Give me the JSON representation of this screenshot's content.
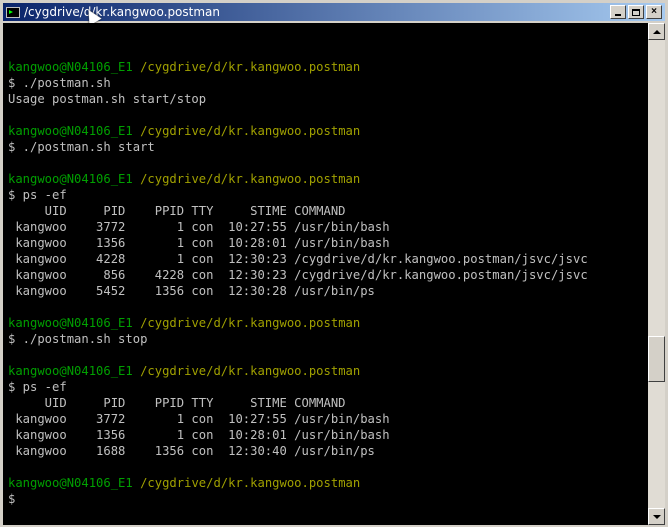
{
  "window": {
    "title": "/cygdrive/d/kr.kangwoo.postman",
    "buttons": {
      "minimize": "_",
      "maximize": "□",
      "close": "×"
    }
  },
  "terminal": {
    "prompt_user": "kangwoo@N04106_E1",
    "prompt_path": "/cygdrive/d/kr.kangwoo.postman",
    "lines": [
      "",
      "__PROMPT__",
      "$ ./postman.sh",
      "Usage postman.sh start/stop",
      "",
      "__PROMPT__",
      "$ ./postman.sh start",
      "",
      "__PROMPT__",
      "$ ps -ef",
      "     UID     PID    PPID TTY     STIME COMMAND",
      " kangwoo    3772       1 con  10:27:55 /usr/bin/bash",
      " kangwoo    1356       1 con  10:28:01 /usr/bin/bash",
      " kangwoo    4228       1 con  12:30:23 /cygdrive/d/kr.kangwoo.postman/jsvc/jsvc",
      " kangwoo     856    4228 con  12:30:23 /cygdrive/d/kr.kangwoo.postman/jsvc/jsvc",
      " kangwoo    5452    1356 con  12:30:28 /usr/bin/ps",
      "",
      "__PROMPT__",
      "$ ./postman.sh stop",
      "",
      "__PROMPT__",
      "$ ps -ef",
      "     UID     PID    PPID TTY     STIME COMMAND",
      " kangwoo    3772       1 con  10:27:55 /usr/bin/bash",
      " kangwoo    1356       1 con  10:28:01 /usr/bin/bash",
      " kangwoo    1688    1356 con  12:30:40 /usr/bin/ps",
      "",
      "__PROMPT__",
      "$"
    ]
  },
  "colors": {
    "title_gradient_start": "#0a246a",
    "title_gradient_end": "#a6caf0",
    "terminal_bg": "#000000",
    "text": "#c0c0c0",
    "user": "#00a000",
    "path": "#a0a000"
  }
}
